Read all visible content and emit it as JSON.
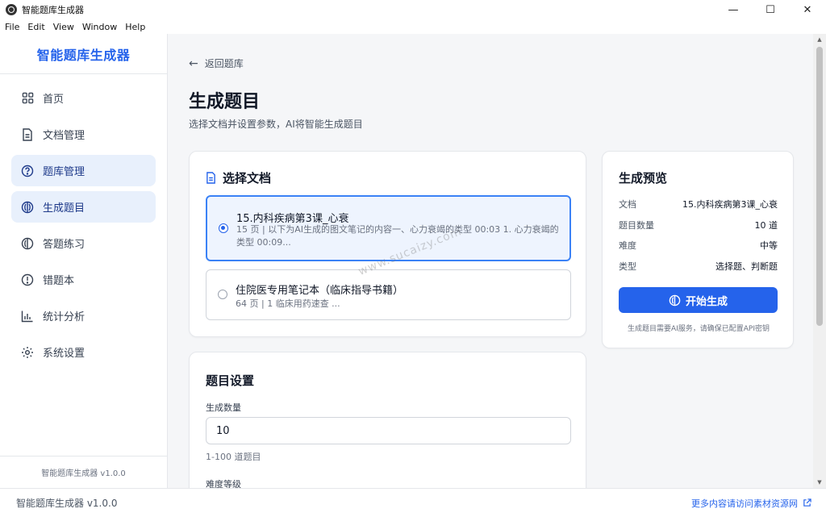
{
  "window": {
    "title": "智能题库生成器",
    "controls": {
      "minimize": "—",
      "maximize": "☐",
      "close": "✕"
    }
  },
  "menu": [
    "File",
    "Edit",
    "View",
    "Window",
    "Help"
  ],
  "sidebar": {
    "brand": "智能题库生成器",
    "items": [
      {
        "label": "首页",
        "icon": "grid-icon"
      },
      {
        "label": "文档管理",
        "icon": "document-icon"
      },
      {
        "label": "题库管理",
        "icon": "question-circle-icon"
      },
      {
        "label": "生成题目",
        "icon": "sparkle-circle-icon"
      },
      {
        "label": "答题练习",
        "icon": "practice-circle-icon"
      },
      {
        "label": "错题本",
        "icon": "mistake-circle-icon"
      },
      {
        "label": "统计分析",
        "icon": "bar-chart-icon"
      },
      {
        "label": "系统设置",
        "icon": "gear-icon"
      }
    ],
    "footer": "智能题库生成器 v1.0.0"
  },
  "main": {
    "back": "返回题库",
    "title": "生成题目",
    "subtitle": "选择文档并设置参数，AI将智能生成题目",
    "docs_card": {
      "title": "选择文档",
      "options": [
        {
          "name": "15.内科疾病第3课_心衰",
          "desc": "15 页 | 以下为AI生成的图文笔记的内容一、心力衰竭的类型 00:03 1. 心力衰竭的类型 00:09...",
          "selected": true
        },
        {
          "name": "住院医专用笔记本（临床指导书籍）",
          "desc": "64 页 | 1 临床用药速查 ...",
          "selected": false
        }
      ]
    },
    "watermark": "www.sucaizy.com",
    "settings_card": {
      "title": "题目设置",
      "count_label": "生成数量",
      "count_value": "10",
      "count_hint": "1-100 道题目",
      "difficulty_label": "难度等级"
    },
    "preview_card": {
      "title": "生成预览",
      "rows": [
        {
          "key": "文档",
          "value": "15.内科疾病第3课_心衰"
        },
        {
          "key": "题目数量",
          "value": "10 道"
        },
        {
          "key": "难度",
          "value": "中等"
        },
        {
          "key": "类型",
          "value": "选择题、判断题"
        }
      ],
      "button": "开始生成",
      "note": "生成题目需要AI服务，请确保已配置API密钥"
    }
  },
  "statusbar": {
    "left": "智能题库生成器 v1.0.0",
    "link": "更多内容请访问素材资源网"
  },
  "colors": {
    "accent": "#2563eb",
    "active_bg": "#e8f0fc",
    "main_bg": "#f5f6f8"
  }
}
